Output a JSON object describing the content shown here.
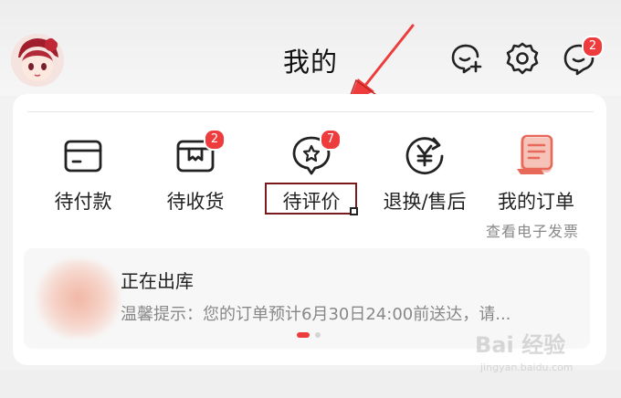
{
  "header": {
    "title": "我的",
    "add_friend_icon": "add-person-icon",
    "settings_icon": "gear-icon",
    "message_icon": "chat-bubble-icon",
    "message_badge": "2"
  },
  "order_items": [
    {
      "label": "待付款",
      "icon": "wallet-card-icon",
      "badge": ""
    },
    {
      "label": "待收货",
      "icon": "package-box-icon",
      "badge": "2"
    },
    {
      "label": "待评价",
      "icon": "star-bubble-icon",
      "badge": "7"
    },
    {
      "label": "退换/售后",
      "icon": "yen-refresh-icon",
      "badge": ""
    },
    {
      "label": "我的订单",
      "icon": "order-list-icon",
      "badge": ""
    }
  ],
  "invoice_link": "查看电子发票",
  "status": {
    "title": "正在出库",
    "description": "温馨提示：您的订单预计6月30日24:00前送达，请..."
  },
  "colors": {
    "accent": "#ee3b3b",
    "highlight_box": "#7a1a1a",
    "order_icon_red": "#e8685a"
  },
  "watermark": {
    "text": "Bai 经验",
    "sub": "jingyan.baidu.com"
  }
}
